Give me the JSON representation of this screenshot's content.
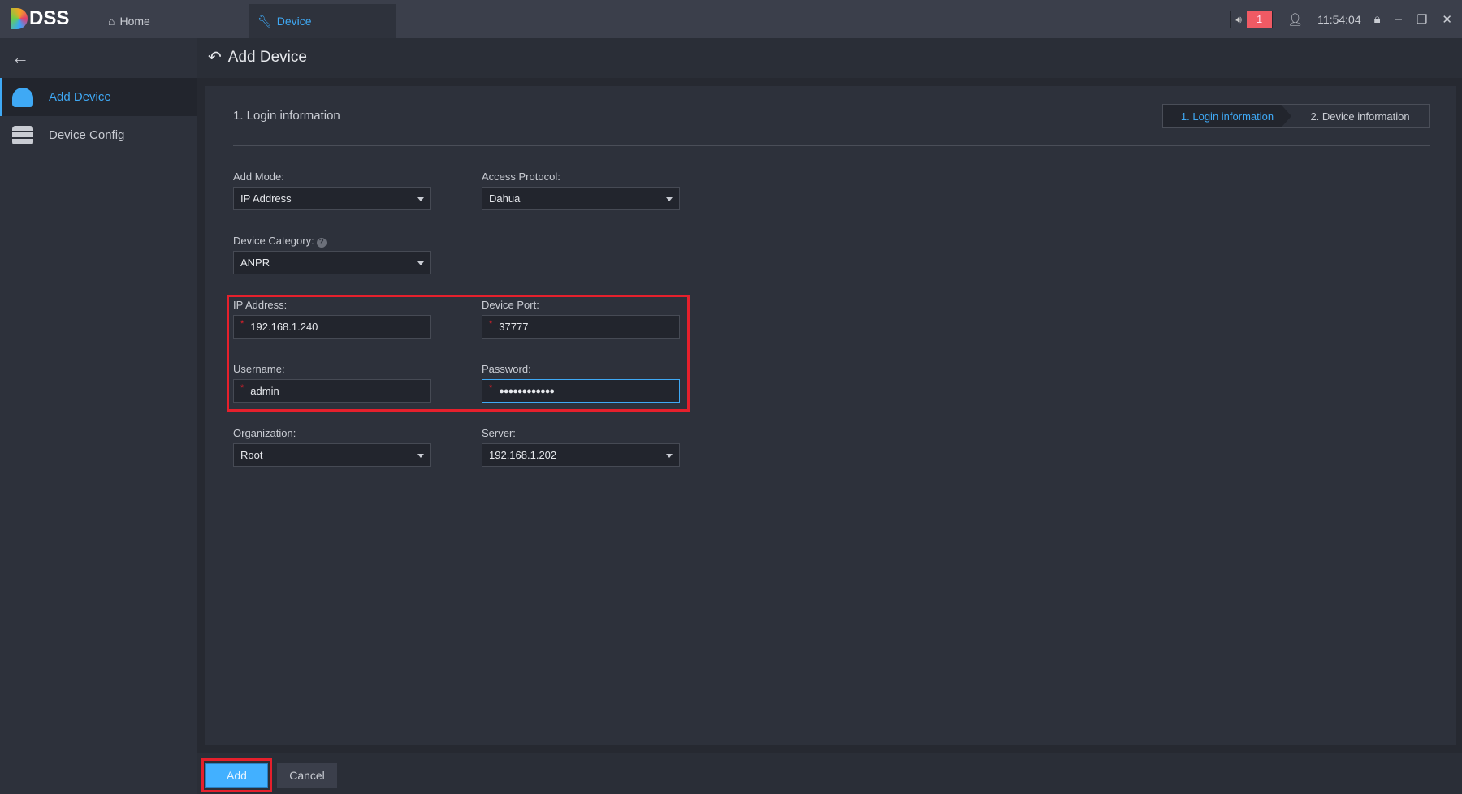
{
  "app": {
    "logo_text": "DSS"
  },
  "tabs": [
    {
      "label": "Home",
      "icon": "home-icon"
    },
    {
      "label": "Device",
      "icon": "wrench-icon",
      "active": true
    }
  ],
  "tray": {
    "alarm_count": "1",
    "time": "11:54:04"
  },
  "sidebar": {
    "items": [
      {
        "label": "Add Device",
        "active": true
      },
      {
        "label": "Device Config"
      }
    ]
  },
  "header": {
    "title": "Add Device"
  },
  "section": {
    "title": "1. Login information"
  },
  "steps": [
    {
      "label": "1. Login information",
      "active": true
    },
    {
      "label": "2. Device information"
    }
  ],
  "form": {
    "add_mode": {
      "label": "Add Mode:",
      "value": "IP Address"
    },
    "access_protocol": {
      "label": "Access Protocol:",
      "value": "Dahua"
    },
    "device_category": {
      "label": "Device Category:",
      "value": "ANPR"
    },
    "ip_address": {
      "label": "IP Address:",
      "value": "192.168.1.240"
    },
    "device_port": {
      "label": "Device Port:",
      "value": "37777"
    },
    "username": {
      "label": "Username:",
      "value": "admin"
    },
    "password": {
      "label": "Password:",
      "value": "●●●●●●●●●●●●"
    },
    "organization": {
      "label": "Organization:",
      "value": "Root"
    },
    "server": {
      "label": "Server:",
      "value": "192.168.1.202"
    }
  },
  "footer": {
    "add_label": "Add",
    "cancel_label": "Cancel"
  },
  "colors": {
    "accent": "#3fa9f5",
    "highlight": "#e5202c",
    "alarm": "#f05a64"
  }
}
